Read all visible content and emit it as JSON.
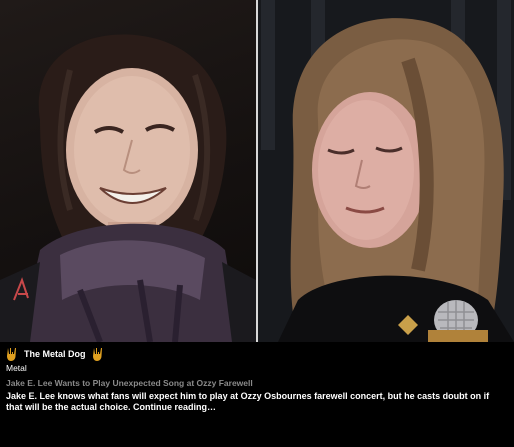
{
  "source": {
    "name": "The Metal Dog",
    "icon": "devil-horns-icon",
    "icon_color": "#e0a020"
  },
  "category": "Metal",
  "article": {
    "title": "Jake E. Lee Wants to Play Unexpected Song at Ozzy Farewell",
    "summary": "Jake E. Lee knows what fans will expect him to play at Ozzy Osbournes farewell concert, but he casts doubt on if that will be the actual choice. Continue reading…"
  },
  "colors": {
    "background": "#000000",
    "headline": "#8a8a8a",
    "text": "#ffffff"
  }
}
